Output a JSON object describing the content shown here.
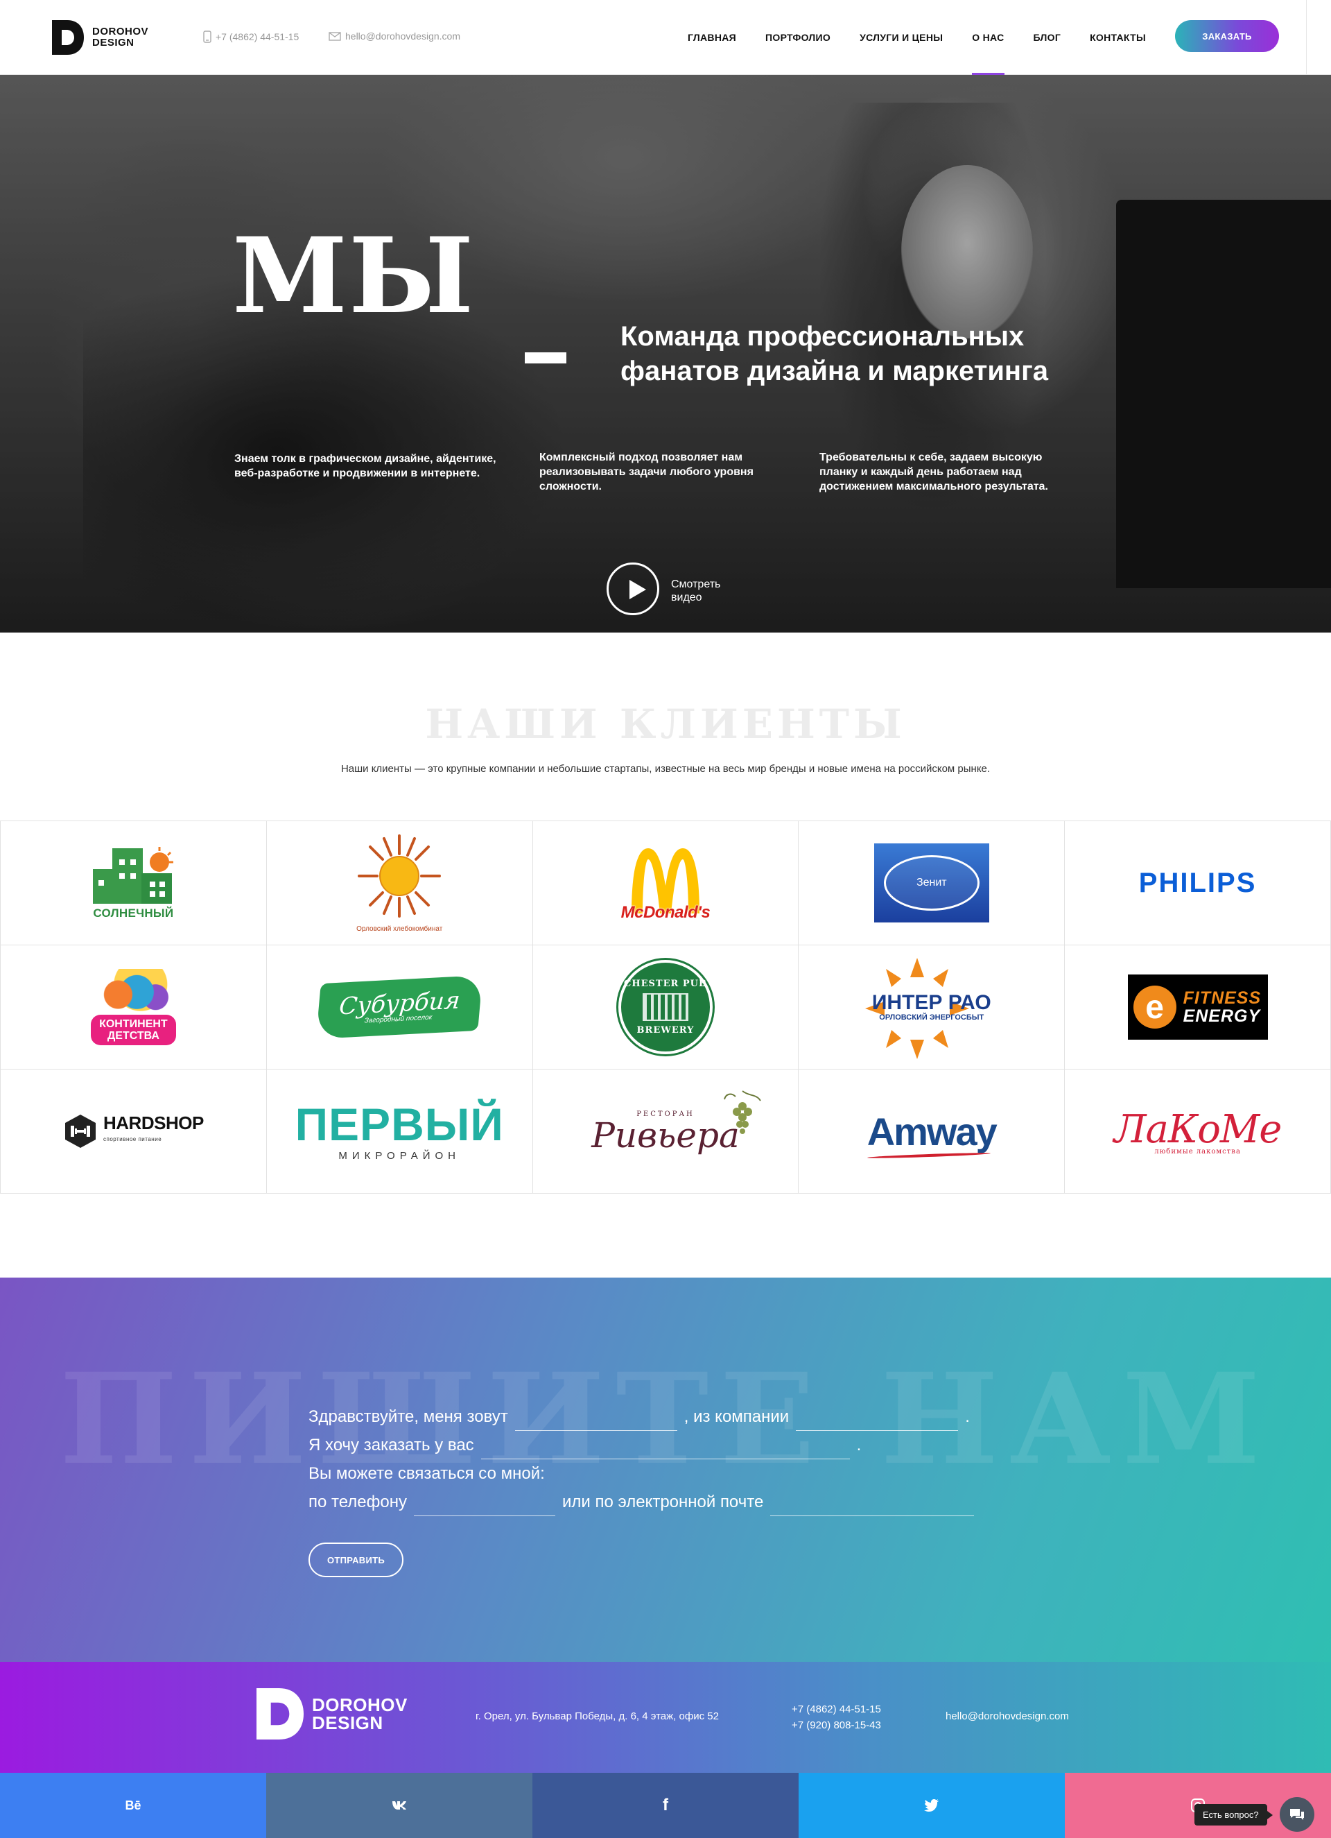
{
  "header": {
    "logo": {
      "line1": "DOROHOV",
      "line2": "DESIGN"
    },
    "phone": "+7 (4862) 44-51-15",
    "email": "hello@dorohovdesign.com",
    "nav": [
      {
        "label": "ГЛАВНАЯ"
      },
      {
        "label": "ПОРТФОЛИО"
      },
      {
        "label": "УСЛУГИ И ЦЕНЫ"
      },
      {
        "label": "О НАС",
        "active": true
      },
      {
        "label": "БЛОГ"
      },
      {
        "label": "КОНТАКТЫ"
      }
    ],
    "order_button": "ЗАКАЗАТЬ",
    "active_color": "#8e44e0"
  },
  "hero": {
    "big_word": "МЫ",
    "title": "Команда профессиональных фанатов дизайна и маркетинга",
    "columns": [
      "Знаем толк в графическом дизайне, айдентике, веб-разработке и продвижении в интернете.",
      "Комплексный подход позволяет нам реализовывать задачи любого уровня сложности.",
      "Требовательны к себе, задаем высокую планку и каждый день работаем над достижением максимального результата."
    ],
    "play_label": "Смотреть видео"
  },
  "clients": {
    "title": "НАШИ КЛИЕНТЫ",
    "subtitle": "Наши клиенты — это крупные компании и небольшие стартапы, известные на весь мир бренды и новые имена на российском рынке.",
    "logos": {
      "solnechny": "СОЛНЕЧНЫЙ",
      "orel_bread": "Орловский хлебокомбинат",
      "mcdonalds": "McDonald's",
      "zenit": "Зенит",
      "philips": "PHILIPS",
      "continent_1": "КОНТИНЕНТ",
      "continent_2": "ДЕТСТВА",
      "suburbia": "Субурбия",
      "suburbia_sub": "Загородный поселок",
      "chester_top": "CHESTER PUB",
      "chester_bottom": "BREWERY",
      "interrao": "ИНТЕР РАО",
      "interrao_sub": "ОРЛОВСКИЙ ЭНЕРГОСБЫТ",
      "fitness_1": "FITNESS",
      "fitness_2": "ENERGY",
      "hardshop": "HARDSHOP",
      "hardshop_sub": "спортивное питание",
      "perviy": "ПЕРВЫЙ",
      "perviy_sub": "МИКРОРАЙОН",
      "riviera_sub": "РЕСТОРАН",
      "riviera": "Ривьера",
      "amway": "Amway",
      "lakome": "ЛаКоМе",
      "lakome_sub": "любимые лакомства"
    }
  },
  "contact": {
    "bg_title": "ПИШИТЕ НАМ",
    "line1_a": "Здравствуйте, меня зовут",
    "line1_b": ", из компании",
    "line1_c": ".",
    "line2_a": "Я хочу заказать у вас",
    "line2_b": ".",
    "line3": "Вы можете связаться со мной:",
    "line4_a": "по телефону",
    "line4_b": "или по электронной почте",
    "send_button": "ОТПРАВИТЬ"
  },
  "footer": {
    "logo": {
      "line1": "DOROHOV",
      "line2": "DESIGN"
    },
    "address": "г. Орел, ул. Бульвар Победы, д. 6, 4 этаж, офис 52",
    "phone1": "+7 (4862) 44-51-15",
    "phone2": "+7 (920) 808-15-43",
    "email": "hello@dorohovdesign.com"
  },
  "social": {
    "behance": "Bē",
    "vk": "vk",
    "facebook": "f",
    "twitter": "twitter",
    "instagram": "instagram"
  },
  "chat": {
    "label": "Есть вопрос?"
  }
}
